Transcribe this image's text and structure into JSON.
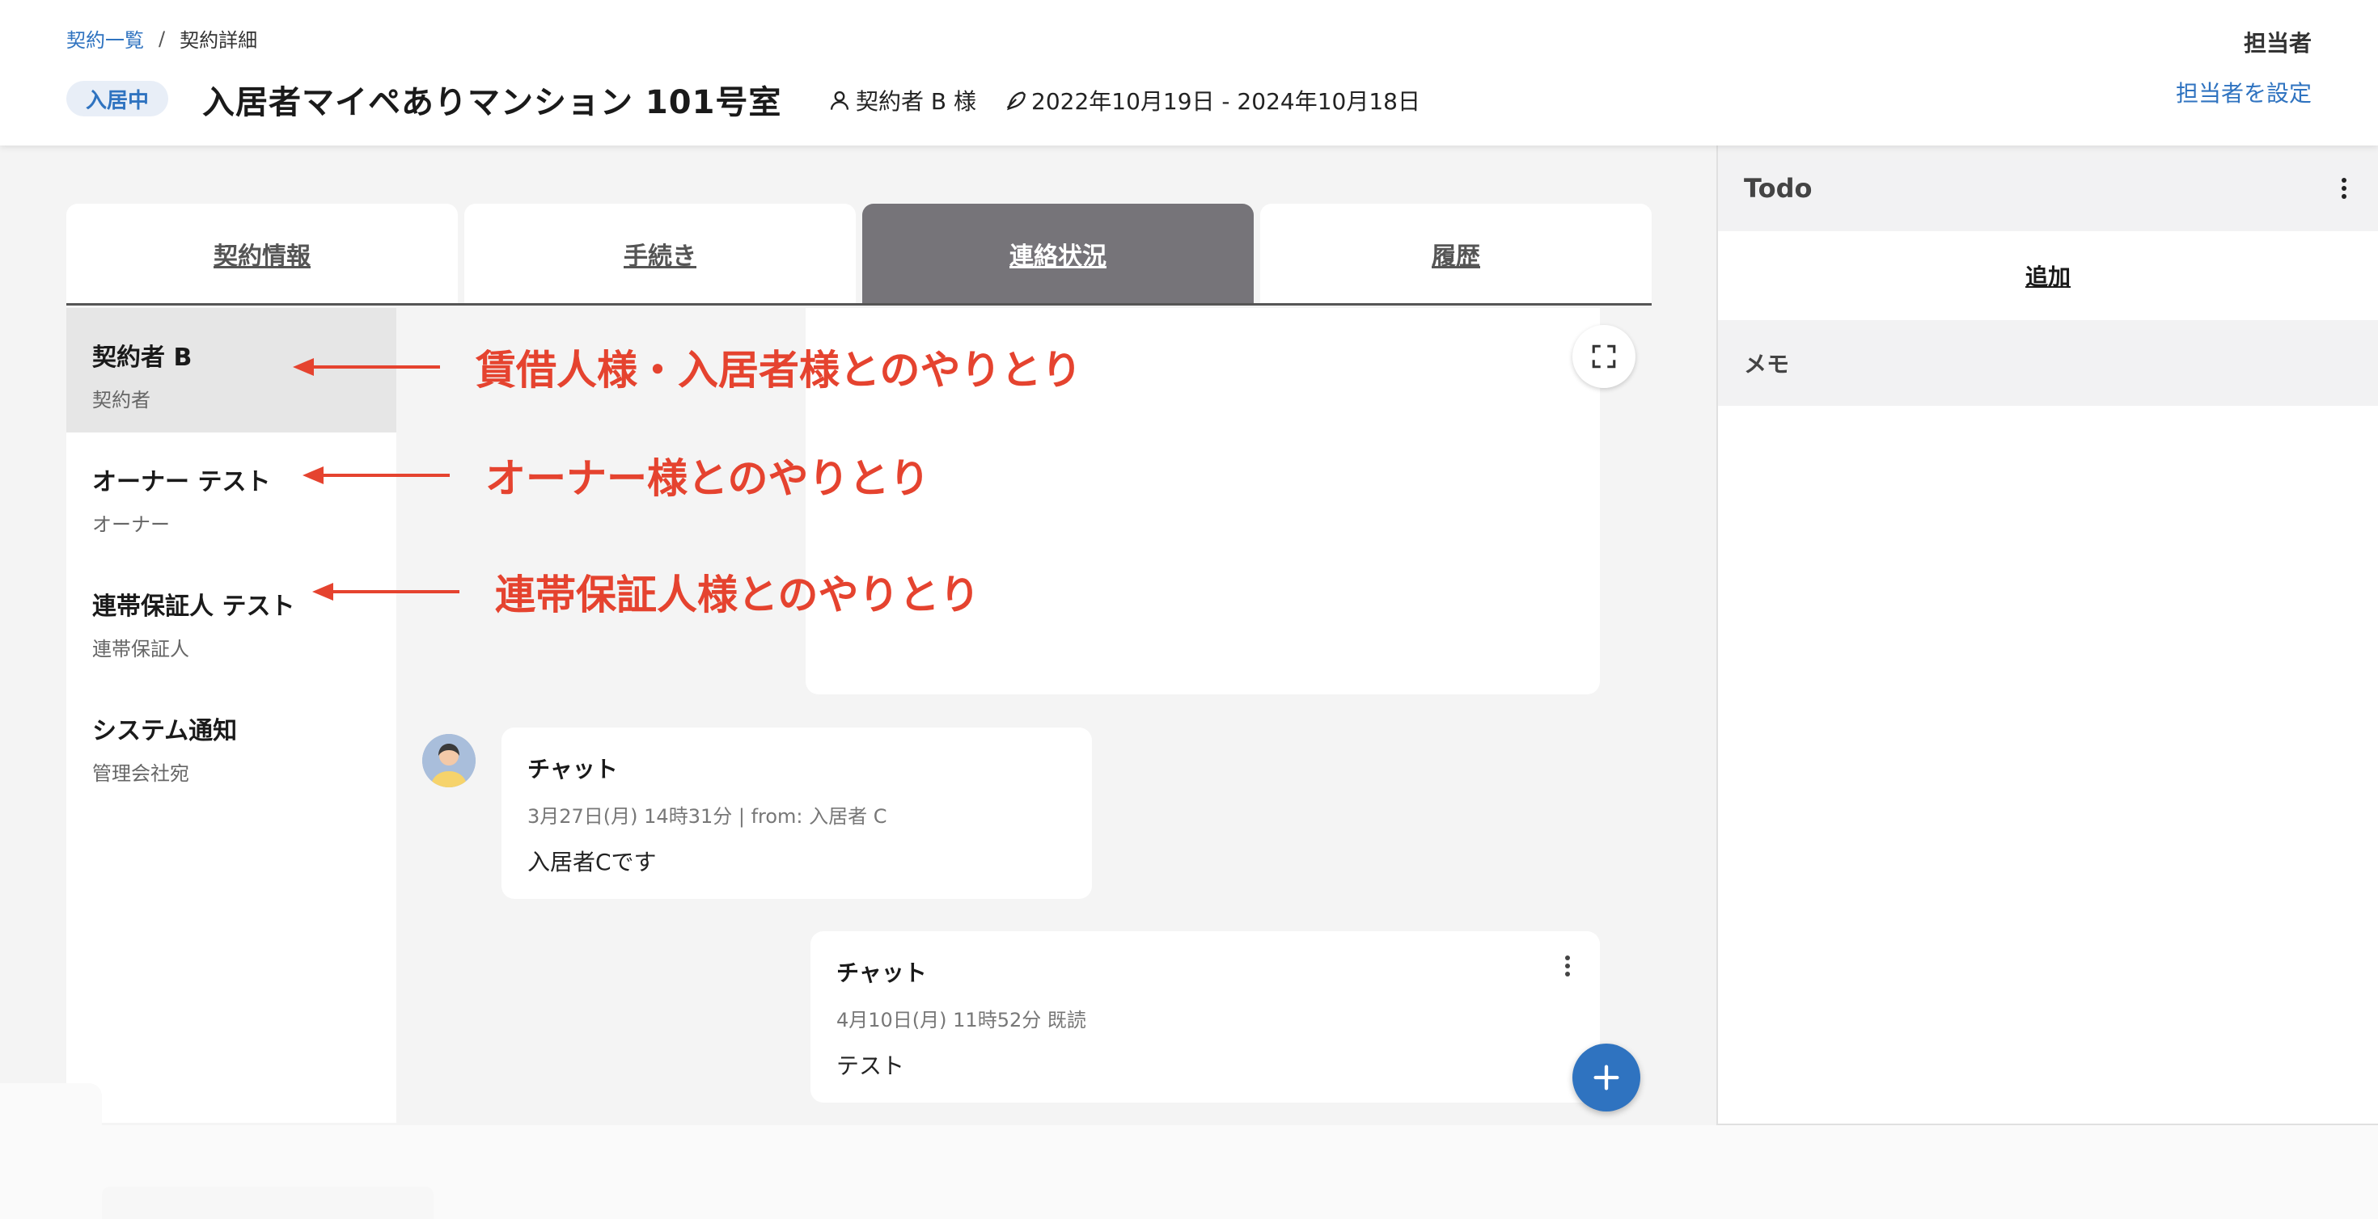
{
  "breadcrumb": {
    "parent": "契約一覧",
    "separator": "/",
    "current": "契約詳細"
  },
  "header": {
    "status_badge": "入居中",
    "title": "入居者マイペありマンション 101号室",
    "contractor": "契約者 B 様",
    "period": "2022年10月19日 - 2024年10月18日",
    "assignee_title": "担当者",
    "assignee_link": "担当者を設定"
  },
  "tabs": [
    {
      "label": "契約情報"
    },
    {
      "label": "手続き"
    },
    {
      "label": "連絡状況",
      "active": true
    },
    {
      "label": "履歴"
    }
  ],
  "contacts": [
    {
      "name": "契約者 B",
      "role": "契約者",
      "active": true
    },
    {
      "name": "オーナー テスト",
      "role": "オーナー"
    },
    {
      "name": "連帯保証人 テスト",
      "role": "連帯保証人"
    },
    {
      "name": "システム通知",
      "role": "管理会社宛"
    }
  ],
  "messages": [
    {
      "title": "チャット",
      "meta": "3月27日(月) 14時31分 | from: 入居者 C",
      "body": "入居者Cです"
    },
    {
      "title": "チャット",
      "meta": "4月10日(月) 11時52分  既読",
      "body": "テスト"
    }
  ],
  "right_panel": {
    "todo_title": "Todo",
    "todo_add": "追加",
    "memo_title": "メモ"
  },
  "annotations": [
    "賃借人様・入居者様とのやりとり",
    "オーナー様とのやりとり",
    "連帯保証人様とのやりとり"
  ],
  "colors": {
    "accent": "#2f73c0",
    "active_tab": "#767479",
    "annotation": "#e5432f"
  },
  "icons": [
    "person-icon",
    "pen-icon",
    "expand-icon",
    "kebab-menu-icon",
    "plus-icon",
    "arrow-left-icon"
  ]
}
